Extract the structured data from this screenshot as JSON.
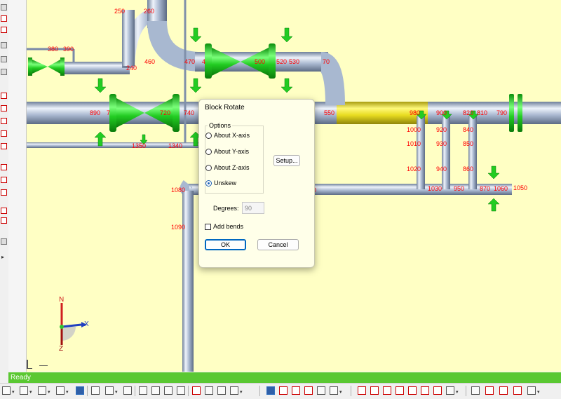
{
  "dialog": {
    "title": "Block Rotate",
    "options_legend": "Options",
    "options": [
      {
        "label": "About X-axis",
        "selected": false
      },
      {
        "label": "About Y-axis",
        "selected": false
      },
      {
        "label": "About Z-axis",
        "selected": false
      },
      {
        "label": "Unskew",
        "selected": true
      }
    ],
    "setup_label": "Setup...",
    "degrees_label": "Degrees:",
    "degrees_value": "90",
    "add_bends_label": "Add bends",
    "add_bends_checked": false,
    "ok_label": "OK",
    "cancel_label": "Cancel"
  },
  "status": {
    "text": "Ready"
  },
  "axis": {
    "north": "N",
    "x": "X",
    "z": "Z"
  },
  "node_labels": [
    "250",
    "260",
    "380",
    "390",
    "240",
    "460",
    "470",
    "4",
    "500",
    "520",
    "530",
    "70",
    "890",
    "7",
    "720",
    "740",
    "550",
    "980",
    "900",
    "820",
    "810",
    "790",
    "1000",
    "920",
    "840",
    "1010",
    "930",
    "850",
    "1020",
    "940",
    "860",
    "1030",
    "950",
    "870",
    "1060",
    "1050",
    "1080",
    "1090",
    "1350",
    "1340",
    "0"
  ],
  "colors": {
    "viewport_bg": "#ffffc4",
    "pipe": "#a8b8d0",
    "valve": "#22cc22",
    "highlight_pipe": "#e8dc20",
    "label": "#ff0000",
    "status_bg": "#5ac832"
  }
}
